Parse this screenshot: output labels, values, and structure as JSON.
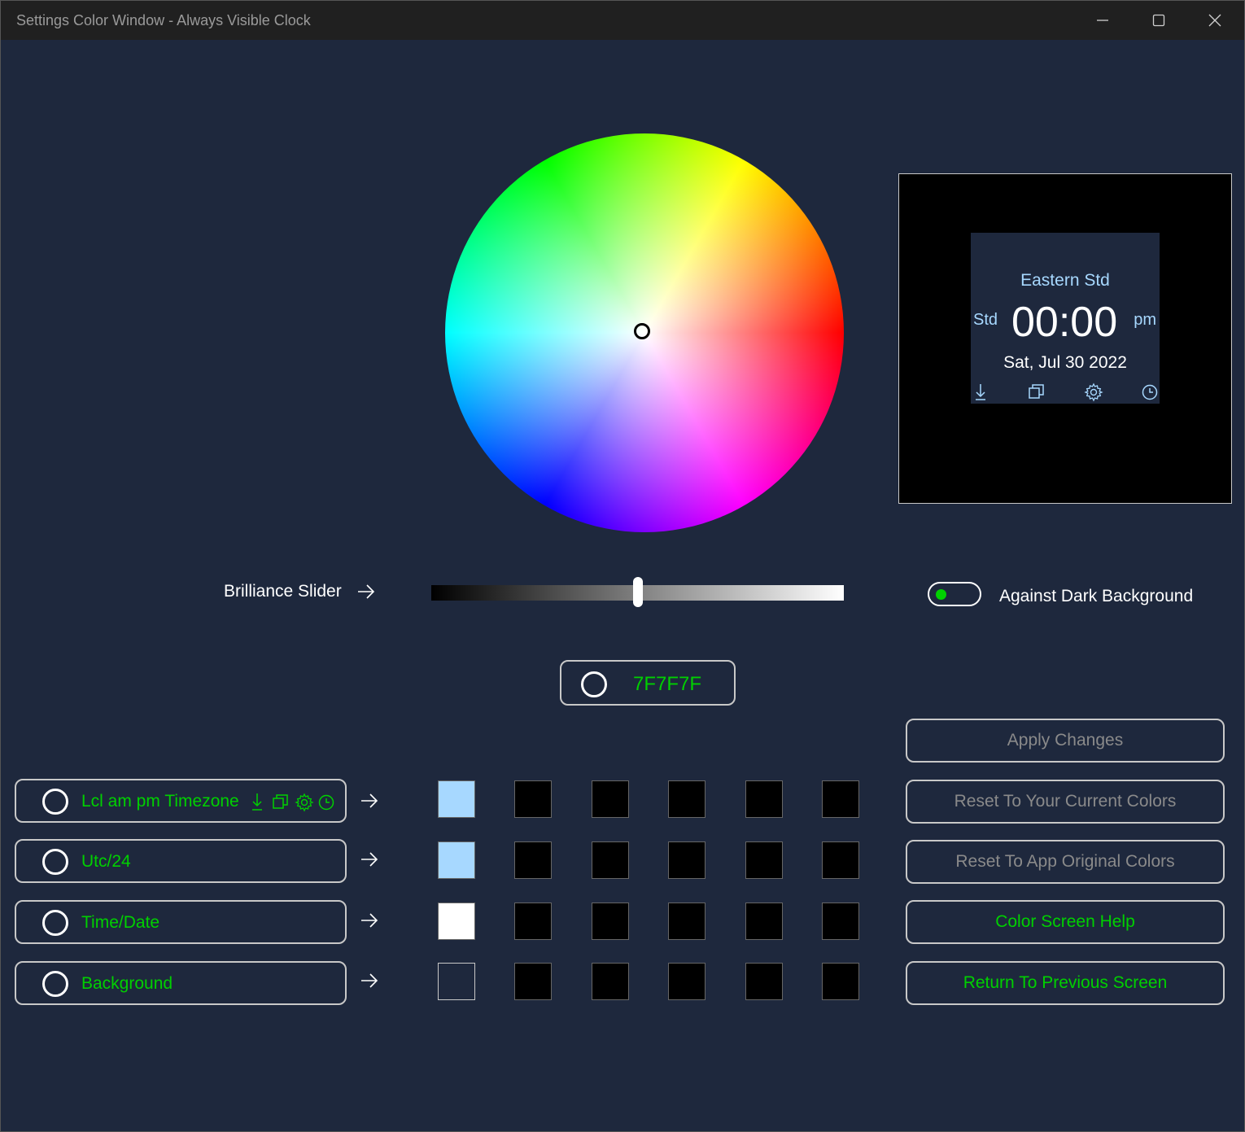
{
  "window": {
    "title": "Settings Color Window - Always Visible Clock",
    "min_icon": "minimize-icon",
    "max_icon": "maximize-icon",
    "close_icon": "close-icon"
  },
  "preview": {
    "timezone": "Eastern Std",
    "std": "Std",
    "time": "00:00",
    "ampm": "pm",
    "date": "Sat, Jul 30 2022",
    "icons": [
      "download-icon",
      "copy-icon",
      "gear-icon",
      "clock-icon"
    ]
  },
  "brilliance": {
    "label": "Brilliance Slider",
    "value": 0.5
  },
  "toggle": {
    "label": "Against Dark Background",
    "on": true
  },
  "hex": {
    "value": "7F7F7F"
  },
  "rows": [
    {
      "label": "Lcl am pm Timezone",
      "icons": [
        "download-icon",
        "copy-icon",
        "gear-icon",
        "clock-icon"
      ],
      "swatches": [
        "#a7d8ff",
        "#000000",
        "#000000",
        "#000000",
        "#000000",
        "#000000"
      ]
    },
    {
      "label": "Utc/24",
      "swatches": [
        "#a7d8ff",
        "#000000",
        "#000000",
        "#000000",
        "#000000",
        "#000000"
      ]
    },
    {
      "label": "Time/Date",
      "swatches": [
        "#ffffff",
        "#000000",
        "#000000",
        "#000000",
        "#000000",
        "#000000"
      ]
    },
    {
      "label": "Background",
      "swatches": [
        "#1e283d",
        "#000000",
        "#000000",
        "#000000",
        "#000000",
        "#000000"
      ]
    }
  ],
  "actions": {
    "apply": "Apply Changes",
    "reset_current": "Reset To Your Current Colors",
    "reset_original": "Reset To App Original Colors",
    "help": "Color Screen Help",
    "return": "Return To Previous Screen"
  },
  "colors": {
    "background": "#1e283d",
    "accent_green": "#00d000",
    "light_blue": "#a7d8ff"
  }
}
